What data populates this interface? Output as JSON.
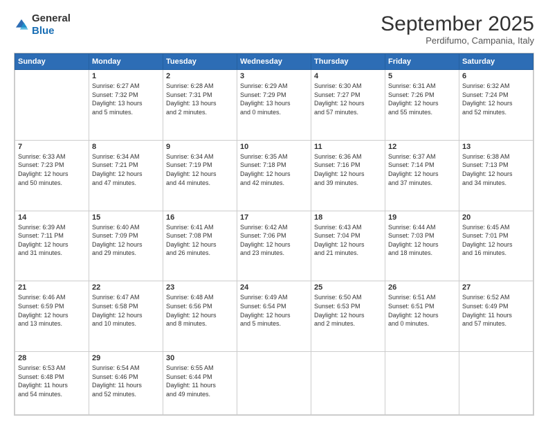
{
  "logo": {
    "text_general": "General",
    "text_blue": "Blue"
  },
  "header": {
    "month": "September 2025",
    "location": "Perdifumo, Campania, Italy"
  },
  "weekdays": [
    "Sunday",
    "Monday",
    "Tuesday",
    "Wednesday",
    "Thursday",
    "Friday",
    "Saturday"
  ],
  "weeks": [
    [
      {
        "day": "",
        "info": ""
      },
      {
        "day": "1",
        "info": "Sunrise: 6:27 AM\nSunset: 7:32 PM\nDaylight: 13 hours\nand 5 minutes."
      },
      {
        "day": "2",
        "info": "Sunrise: 6:28 AM\nSunset: 7:31 PM\nDaylight: 13 hours\nand 2 minutes."
      },
      {
        "day": "3",
        "info": "Sunrise: 6:29 AM\nSunset: 7:29 PM\nDaylight: 13 hours\nand 0 minutes."
      },
      {
        "day": "4",
        "info": "Sunrise: 6:30 AM\nSunset: 7:27 PM\nDaylight: 12 hours\nand 57 minutes."
      },
      {
        "day": "5",
        "info": "Sunrise: 6:31 AM\nSunset: 7:26 PM\nDaylight: 12 hours\nand 55 minutes."
      },
      {
        "day": "6",
        "info": "Sunrise: 6:32 AM\nSunset: 7:24 PM\nDaylight: 12 hours\nand 52 minutes."
      }
    ],
    [
      {
        "day": "7",
        "info": "Sunrise: 6:33 AM\nSunset: 7:23 PM\nDaylight: 12 hours\nand 50 minutes."
      },
      {
        "day": "8",
        "info": "Sunrise: 6:34 AM\nSunset: 7:21 PM\nDaylight: 12 hours\nand 47 minutes."
      },
      {
        "day": "9",
        "info": "Sunrise: 6:34 AM\nSunset: 7:19 PM\nDaylight: 12 hours\nand 44 minutes."
      },
      {
        "day": "10",
        "info": "Sunrise: 6:35 AM\nSunset: 7:18 PM\nDaylight: 12 hours\nand 42 minutes."
      },
      {
        "day": "11",
        "info": "Sunrise: 6:36 AM\nSunset: 7:16 PM\nDaylight: 12 hours\nand 39 minutes."
      },
      {
        "day": "12",
        "info": "Sunrise: 6:37 AM\nSunset: 7:14 PM\nDaylight: 12 hours\nand 37 minutes."
      },
      {
        "day": "13",
        "info": "Sunrise: 6:38 AM\nSunset: 7:13 PM\nDaylight: 12 hours\nand 34 minutes."
      }
    ],
    [
      {
        "day": "14",
        "info": "Sunrise: 6:39 AM\nSunset: 7:11 PM\nDaylight: 12 hours\nand 31 minutes."
      },
      {
        "day": "15",
        "info": "Sunrise: 6:40 AM\nSunset: 7:09 PM\nDaylight: 12 hours\nand 29 minutes."
      },
      {
        "day": "16",
        "info": "Sunrise: 6:41 AM\nSunset: 7:08 PM\nDaylight: 12 hours\nand 26 minutes."
      },
      {
        "day": "17",
        "info": "Sunrise: 6:42 AM\nSunset: 7:06 PM\nDaylight: 12 hours\nand 23 minutes."
      },
      {
        "day": "18",
        "info": "Sunrise: 6:43 AM\nSunset: 7:04 PM\nDaylight: 12 hours\nand 21 minutes."
      },
      {
        "day": "19",
        "info": "Sunrise: 6:44 AM\nSunset: 7:03 PM\nDaylight: 12 hours\nand 18 minutes."
      },
      {
        "day": "20",
        "info": "Sunrise: 6:45 AM\nSunset: 7:01 PM\nDaylight: 12 hours\nand 16 minutes."
      }
    ],
    [
      {
        "day": "21",
        "info": "Sunrise: 6:46 AM\nSunset: 6:59 PM\nDaylight: 12 hours\nand 13 minutes."
      },
      {
        "day": "22",
        "info": "Sunrise: 6:47 AM\nSunset: 6:58 PM\nDaylight: 12 hours\nand 10 minutes."
      },
      {
        "day": "23",
        "info": "Sunrise: 6:48 AM\nSunset: 6:56 PM\nDaylight: 12 hours\nand 8 minutes."
      },
      {
        "day": "24",
        "info": "Sunrise: 6:49 AM\nSunset: 6:54 PM\nDaylight: 12 hours\nand 5 minutes."
      },
      {
        "day": "25",
        "info": "Sunrise: 6:50 AM\nSunset: 6:53 PM\nDaylight: 12 hours\nand 2 minutes."
      },
      {
        "day": "26",
        "info": "Sunrise: 6:51 AM\nSunset: 6:51 PM\nDaylight: 12 hours\nand 0 minutes."
      },
      {
        "day": "27",
        "info": "Sunrise: 6:52 AM\nSunset: 6:49 PM\nDaylight: 11 hours\nand 57 minutes."
      }
    ],
    [
      {
        "day": "28",
        "info": "Sunrise: 6:53 AM\nSunset: 6:48 PM\nDaylight: 11 hours\nand 54 minutes."
      },
      {
        "day": "29",
        "info": "Sunrise: 6:54 AM\nSunset: 6:46 PM\nDaylight: 11 hours\nand 52 minutes."
      },
      {
        "day": "30",
        "info": "Sunrise: 6:55 AM\nSunset: 6:44 PM\nDaylight: 11 hours\nand 49 minutes."
      },
      {
        "day": "",
        "info": ""
      },
      {
        "day": "",
        "info": ""
      },
      {
        "day": "",
        "info": ""
      },
      {
        "day": "",
        "info": ""
      }
    ]
  ]
}
